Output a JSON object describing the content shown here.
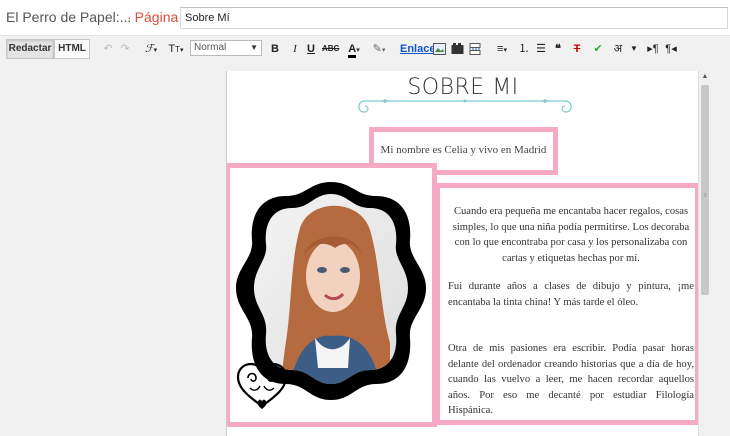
{
  "header": {
    "blog_name": "El Perro de Papel:...",
    "separator": "·",
    "page_type": "Página",
    "title_value": "Sobre Mí"
  },
  "toolbar": {
    "compose_label": "Redactar",
    "html_label": "HTML",
    "undo_icon": "undo-icon",
    "redo_icon": "redo-icon",
    "font_icon": "font-family-icon",
    "size_icon": "font-size-icon",
    "format_value": "Normal",
    "bold_label": "B",
    "italic_label": "I",
    "underline_label": "U",
    "strike_label": "ABC",
    "text_color_label": "A",
    "link_label": "Enlace",
    "hindi_label": "अ"
  },
  "content": {
    "heading": "SOBRE MI",
    "intro": "Mi nombre es Celia y vivo en Madrid",
    "bio": [
      "Cuando era pequeña me encantaba hacer regalos, cosas simples, lo que una niña podía permitirse. Los decoraba con lo que encontraba por casa y los personalizaba con cartas y etiquetas hechas por mí.",
      "Fui durante años a clases de dibujo y pintura, ¡me encantaba la tinta china! Y más tarde el óleo.",
      "Otra de mis pasiones era escribir. Podía pasar horas delante del ordenador creando historias que a día de hoy, cuando las vuelvo a leer, me hacen recordar aquellos años. Por eso me decanté por estudiar Filología Hispánica."
    ]
  },
  "colors": {
    "pink_border": "#f7aac5",
    "flourish_teal": "#7fc9c9",
    "accent_orange": "#dd4b39",
    "link_blue": "#1155cc"
  }
}
